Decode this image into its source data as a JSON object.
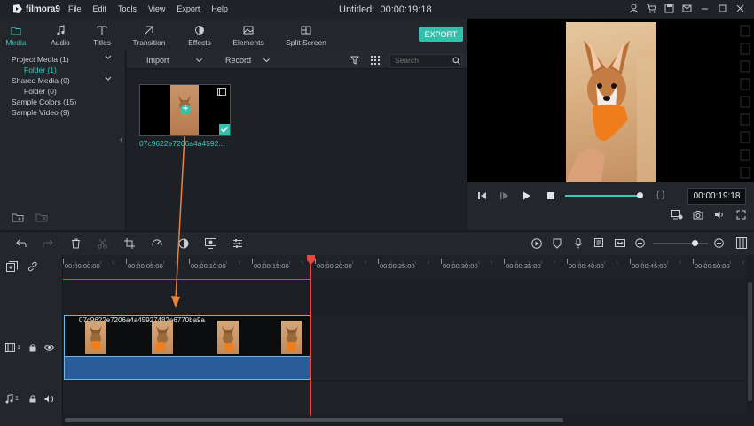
{
  "app": {
    "logo_text": "filmora9",
    "title": "Untitled:",
    "title_time": "00:00:19:18"
  },
  "menu": [
    "File",
    "Edit",
    "Tools",
    "View",
    "Export",
    "Help"
  ],
  "tabs": [
    {
      "label": "Media",
      "icon": "folder-icon",
      "active": true
    },
    {
      "label": "Audio",
      "icon": "music-note-icon"
    },
    {
      "label": "Titles",
      "icon": "title-t-icon"
    },
    {
      "label": "Transition",
      "icon": "transition-icon"
    },
    {
      "label": "Effects",
      "icon": "effects-icon"
    },
    {
      "label": "Elements",
      "icon": "image-icon"
    },
    {
      "label": "Split Screen",
      "icon": "split-screen-icon"
    }
  ],
  "export_label": "EXPORT",
  "tree": {
    "project_media": "Project Media (1)",
    "folder1": "Folder (1)",
    "shared_media": "Shared Media (0)",
    "folder0": "Folder (0)",
    "sample_colors": "Sample Colors (15)",
    "sample_video": "Sample Video (9)"
  },
  "mediabar": {
    "import": "Import",
    "record": "Record",
    "search_placeholder": "Search"
  },
  "media_item": {
    "name": "07c9622e7206a4a4592..."
  },
  "preview": {
    "timecode": "00:00:19:18",
    "progress": 1.0,
    "brackets": "{  }"
  },
  "ruler": {
    "ticks": [
      "00:00:00:00",
      "00:00:05:00",
      "00:00:10:00",
      "00:00:15:00",
      "00:00:20:00",
      "00:00:25:00",
      "00:00:30:00",
      "00:00:35:00",
      "00:00:40:00",
      "00:00:45:00",
      "00:00:50:00"
    ]
  },
  "playhead_time": "00:00:19:18",
  "clip": {
    "name": "07c9622e7206a4a45927482e6770ba9a"
  },
  "tracks": {
    "video_num": "1",
    "audio_num": "1"
  },
  "colors": {
    "accent": "#34c0ab",
    "playhead": "#e5473c",
    "clip_border": "#6fb6ea",
    "audio": "#2b5c9a",
    "arrow": "#e8833a"
  },
  "zoom_level": 0.75
}
